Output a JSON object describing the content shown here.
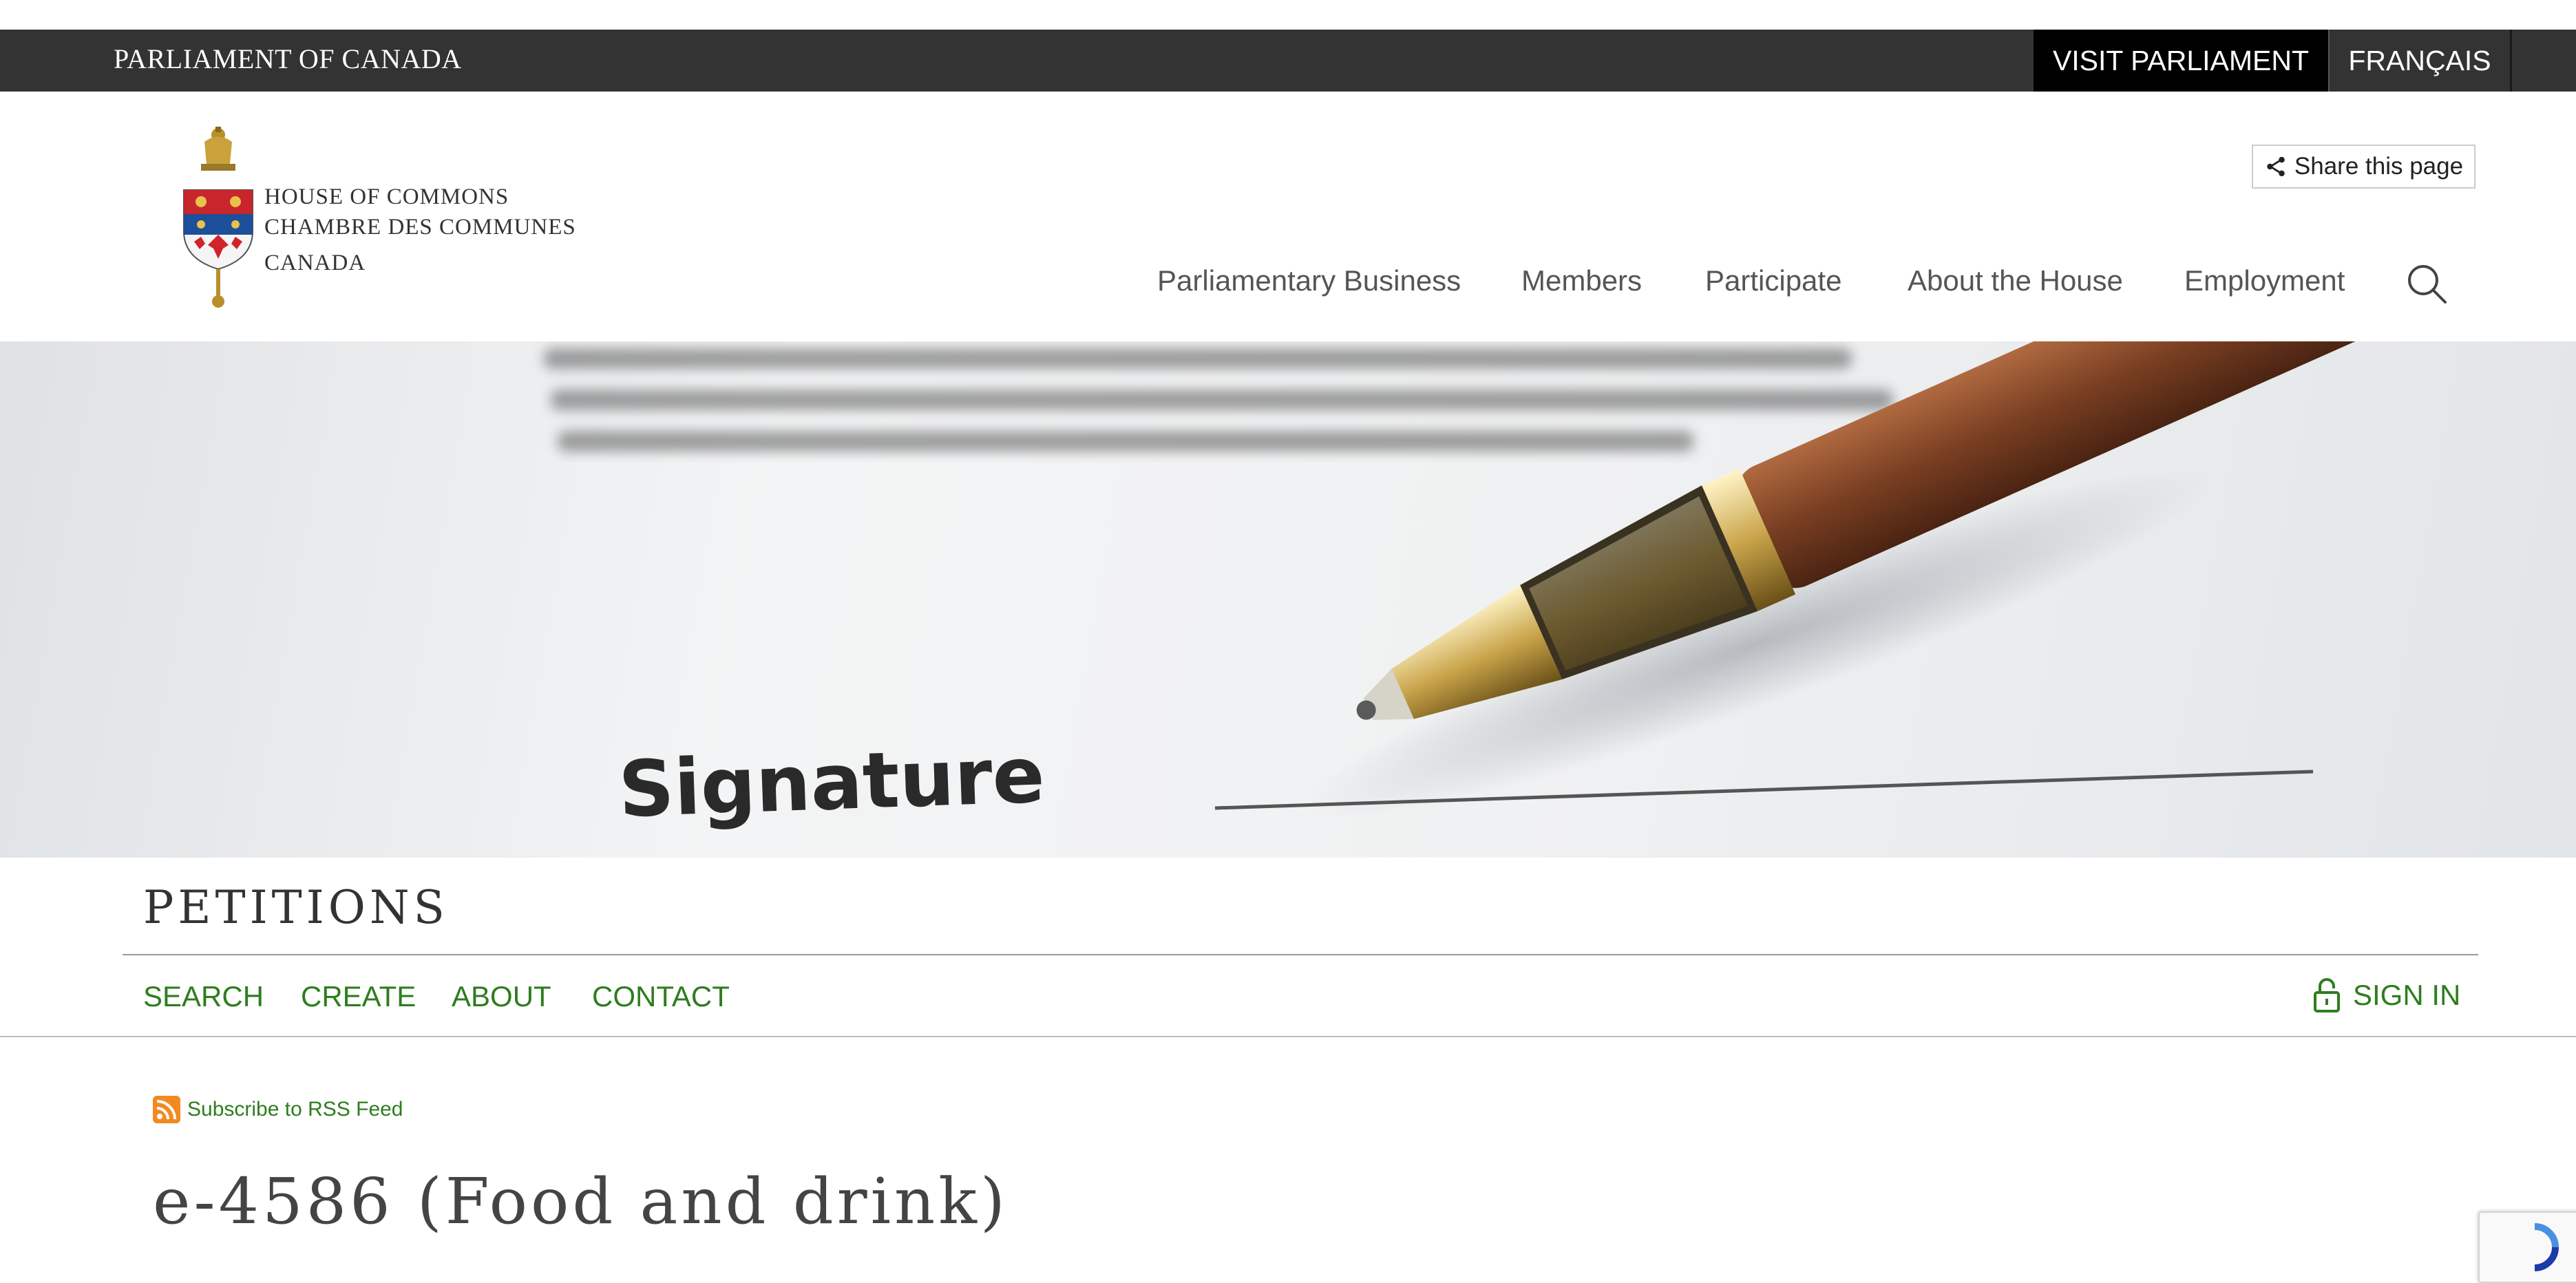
{
  "topbar": {
    "title": "PARLIAMENT OF CANADA",
    "visit_label": "VISIT PARLIAMENT",
    "language_label": "FRANÇAIS"
  },
  "header": {
    "logo": {
      "line1": "HOUSE OF COMMONS",
      "line2": "CHAMBRE DES COMMUNES",
      "line3": "CANADA"
    },
    "share_label": "Share this page",
    "nav": [
      {
        "label": "Parliamentary Business"
      },
      {
        "label": "Members"
      },
      {
        "label": "Participate"
      },
      {
        "label": "About the House"
      },
      {
        "label": "Employment"
      }
    ],
    "search_icon": "search-icon"
  },
  "hero": {
    "signature_text": "Signature",
    "image_subject": "pen-on-signature-line"
  },
  "petitions": {
    "title": "PETITIONS",
    "nav": [
      {
        "label": "SEARCH"
      },
      {
        "label": "CREATE"
      },
      {
        "label": "ABOUT"
      },
      {
        "label": "CONTACT"
      }
    ],
    "signin_label": "SIGN IN",
    "signin_icon": "lock-icon"
  },
  "content": {
    "rss_label": "Subscribe to RSS Feed",
    "rss_icon": "rss-icon",
    "heading": "e-4586 (Food and drink)"
  },
  "colors": {
    "topbar": "#333333",
    "visit_button": "#000000",
    "link_green": "#2e7d1e"
  }
}
